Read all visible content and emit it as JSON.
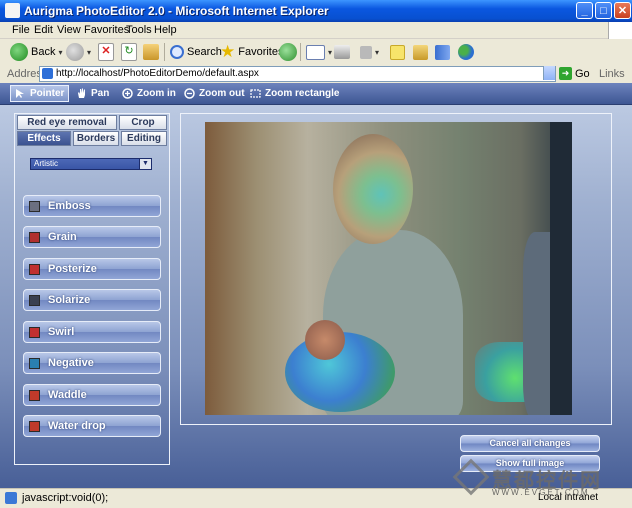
{
  "window": {
    "title": "Aurigma PhotoEditor 2.0 - Microsoft Internet Explorer",
    "minimize_glyph": "_",
    "maximize_glyph": "□",
    "close_glyph": "✕"
  },
  "menu": [
    "File",
    "Edit",
    "View",
    "Favorites",
    "Tools",
    "Help"
  ],
  "toolbar": {
    "back_label": "Back",
    "search_label": "Search",
    "favorites_label": "Favorites"
  },
  "address": {
    "label": "Address",
    "url": "http://localhost/PhotoEditorDemo/default.aspx",
    "go_label": "Go",
    "links_label": "Links"
  },
  "editor_toolbar": {
    "tools": [
      "Pointer",
      "Pan",
      "Zoom in",
      "Zoom out",
      "Zoom rectangle"
    ],
    "active_tool": "Pointer"
  },
  "tabs": {
    "row1": [
      "Red eye removal",
      "Crop"
    ],
    "row2": [
      "Effects",
      "Borders",
      "Editing"
    ],
    "active": "Effects"
  },
  "category_select": {
    "value": "Artistic"
  },
  "effects": [
    {
      "label": "Emboss",
      "icon": "emboss-icon",
      "color": "#6b6f80"
    },
    {
      "label": "Grain",
      "icon": "grain-icon",
      "color": "#b03030"
    },
    {
      "label": "Posterize",
      "icon": "posterize-icon",
      "color": "#c03030"
    },
    {
      "label": "Solarize",
      "icon": "solarize-icon",
      "color": "#3a4050"
    },
    {
      "label": "Swirl",
      "icon": "swirl-icon",
      "color": "#c03030"
    },
    {
      "label": "Negative",
      "icon": "negative-icon",
      "color": "#2a7fb0"
    },
    {
      "label": "Waddle",
      "icon": "waddle-icon",
      "color": "#c03a2a"
    },
    {
      "label": "Water drop",
      "icon": "water-drop-icon",
      "color": "#c03a2a"
    }
  ],
  "actions": {
    "cancel_label": "Cancel all changes",
    "show_full_label": "Show full image"
  },
  "status": {
    "text": "javascript:void(0);",
    "zone": "Local intranet"
  },
  "watermark": {
    "text": "慧都控件网",
    "sub": "WWW.EVGET.COM"
  },
  "colors": {
    "title_blue": "#0a57e0",
    "panel_blue": "#3d5693",
    "content_gradient_top": "#c2cfe6",
    "content_gradient_bottom": "#485f97"
  }
}
